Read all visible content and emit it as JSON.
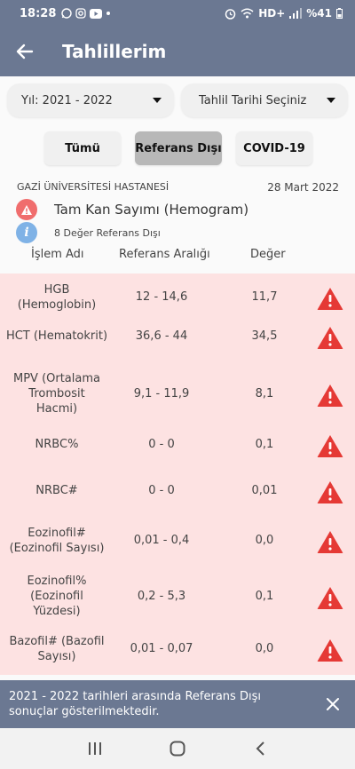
{
  "status_bar": {
    "time": "18:28",
    "left_icons": [
      "whatsapp-icon",
      "instagram-icon",
      "youtube-icon",
      "dot-icon"
    ],
    "network": "HD+",
    "battery": "%41"
  },
  "app_bar": {
    "title": "Tahlillerim",
    "back_icon": "back-arrow-icon"
  },
  "filters": {
    "year": "Yıl: 2021 - 2022",
    "date": "Tahlil Tarihi Seçiniz"
  },
  "tabs": [
    {
      "label": "Tümü",
      "selected": false
    },
    {
      "label": "Referans Dışı",
      "selected": true
    },
    {
      "label": "COVID-19",
      "selected": false
    }
  ],
  "report": {
    "hospital": "GAZİ ÜNİVERSİTESİ HASTANESİ",
    "date": "28 Mart 2022",
    "test_name": "Tam Kan Sayımı (Hemogram)",
    "info": "8 Değer Referans Dışı",
    "info_icon": "i"
  },
  "columns": {
    "name": "İşlem Adı",
    "range": "Referans Aralığı",
    "value": "Değer"
  },
  "rows": [
    {
      "name": "HGB\n(Hemoglobin)",
      "range": "12 - 14,6",
      "value": "11,7"
    },
    {
      "name": "HCT (Hematokrit)",
      "range": "36,6 - 44",
      "value": "34,5"
    },
    {
      "name": "MPV (Ortalama\nTrombosit\nHacmi)",
      "range": "9,1 - 11,9",
      "value": "8,1"
    },
    {
      "name": "NRBC%",
      "range": "0 - 0",
      "value": "0,1"
    },
    {
      "name": "NRBC#",
      "range": "0 - 0",
      "value": "0,01"
    },
    {
      "name": "Eozinofil#\n(Eozinofil Sayısı)",
      "range": "0,01 - 0,4",
      "value": "0,0"
    },
    {
      "name": "Eozinofil%\n(Eozinofil\nYüzdesi)",
      "range": "0,2 - 5,3",
      "value": "0,1"
    },
    {
      "name": "Bazofil# (Bazofil\nSayısı)",
      "range": "0,01 - 0,07",
      "value": "0,0"
    }
  ],
  "snackbar": {
    "message": "2021 - 2022 tarihleri arasında Referans Dışı sonuçlar gösterilmektedir."
  },
  "colors": {
    "header": "#6b7892",
    "row_bg": "#fde2e2",
    "warning": "#e53935"
  }
}
